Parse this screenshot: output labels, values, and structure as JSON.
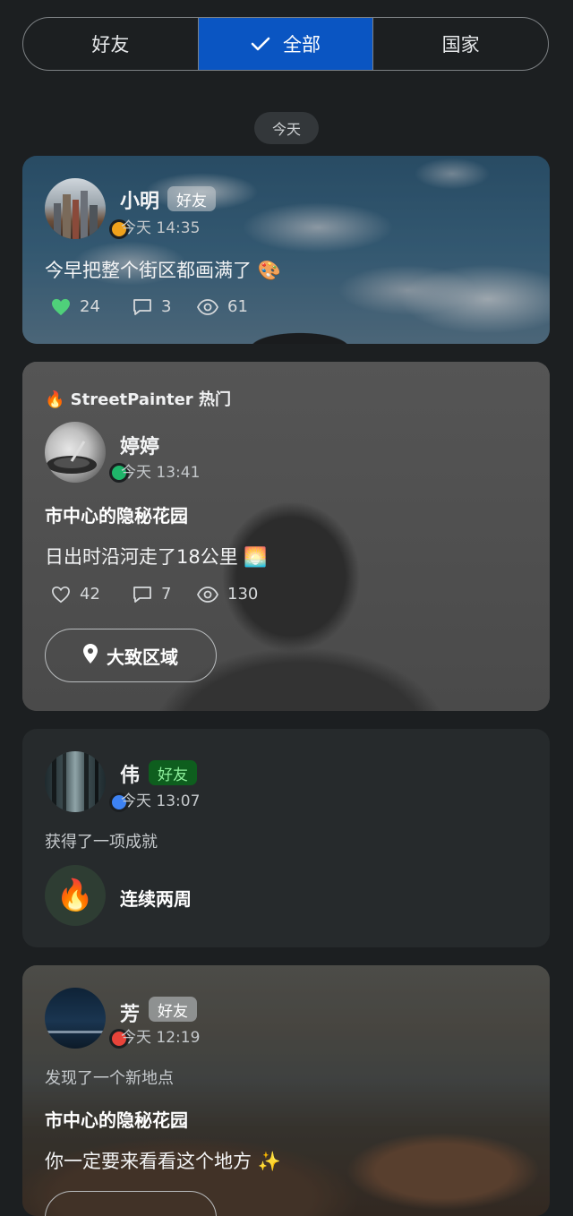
{
  "tabs": [
    {
      "label": "好友",
      "active": false
    },
    {
      "label": "全部",
      "active": true
    },
    {
      "label": "国家",
      "active": false
    }
  ],
  "date_chip": "今天",
  "posts": [
    {
      "name": "小明",
      "badge": "好友",
      "time": "今天 14:35",
      "text": "今早把整个街区都画满了 🎨",
      "likes": "24",
      "comments": "3",
      "views": "61",
      "status_color": "#f0a21c",
      "liked": true
    },
    {
      "tag": "🔥 StreetPainter 热门",
      "name": "婷婷",
      "time": "今天 13:41",
      "title": "市中心的隐秘花园",
      "text": "日出时沿河走了18公里 🌅",
      "likes": "42",
      "comments": "7",
      "views": "130",
      "status_color": "#1fb56a",
      "button": "大致区域"
    },
    {
      "name": "伟",
      "badge": "好友",
      "time": "今天 13:07",
      "subtitle": "获得了一项成就",
      "achievement_icon": "🔥",
      "achievement": "连续两周",
      "status_color": "#3d82f2"
    },
    {
      "name": "芳",
      "badge": "好友",
      "time": "今天 12:19",
      "subtitle": "发现了一个新地点",
      "title": "市中心的隐秘花园",
      "text": "你一定要来看看这个地方 ✨",
      "status_color": "#e8443a"
    }
  ],
  "colors": {
    "accent": "#0a55c2",
    "background": "#1c1f21",
    "card": "#262a2c",
    "like_active": "#4fd07a"
  }
}
